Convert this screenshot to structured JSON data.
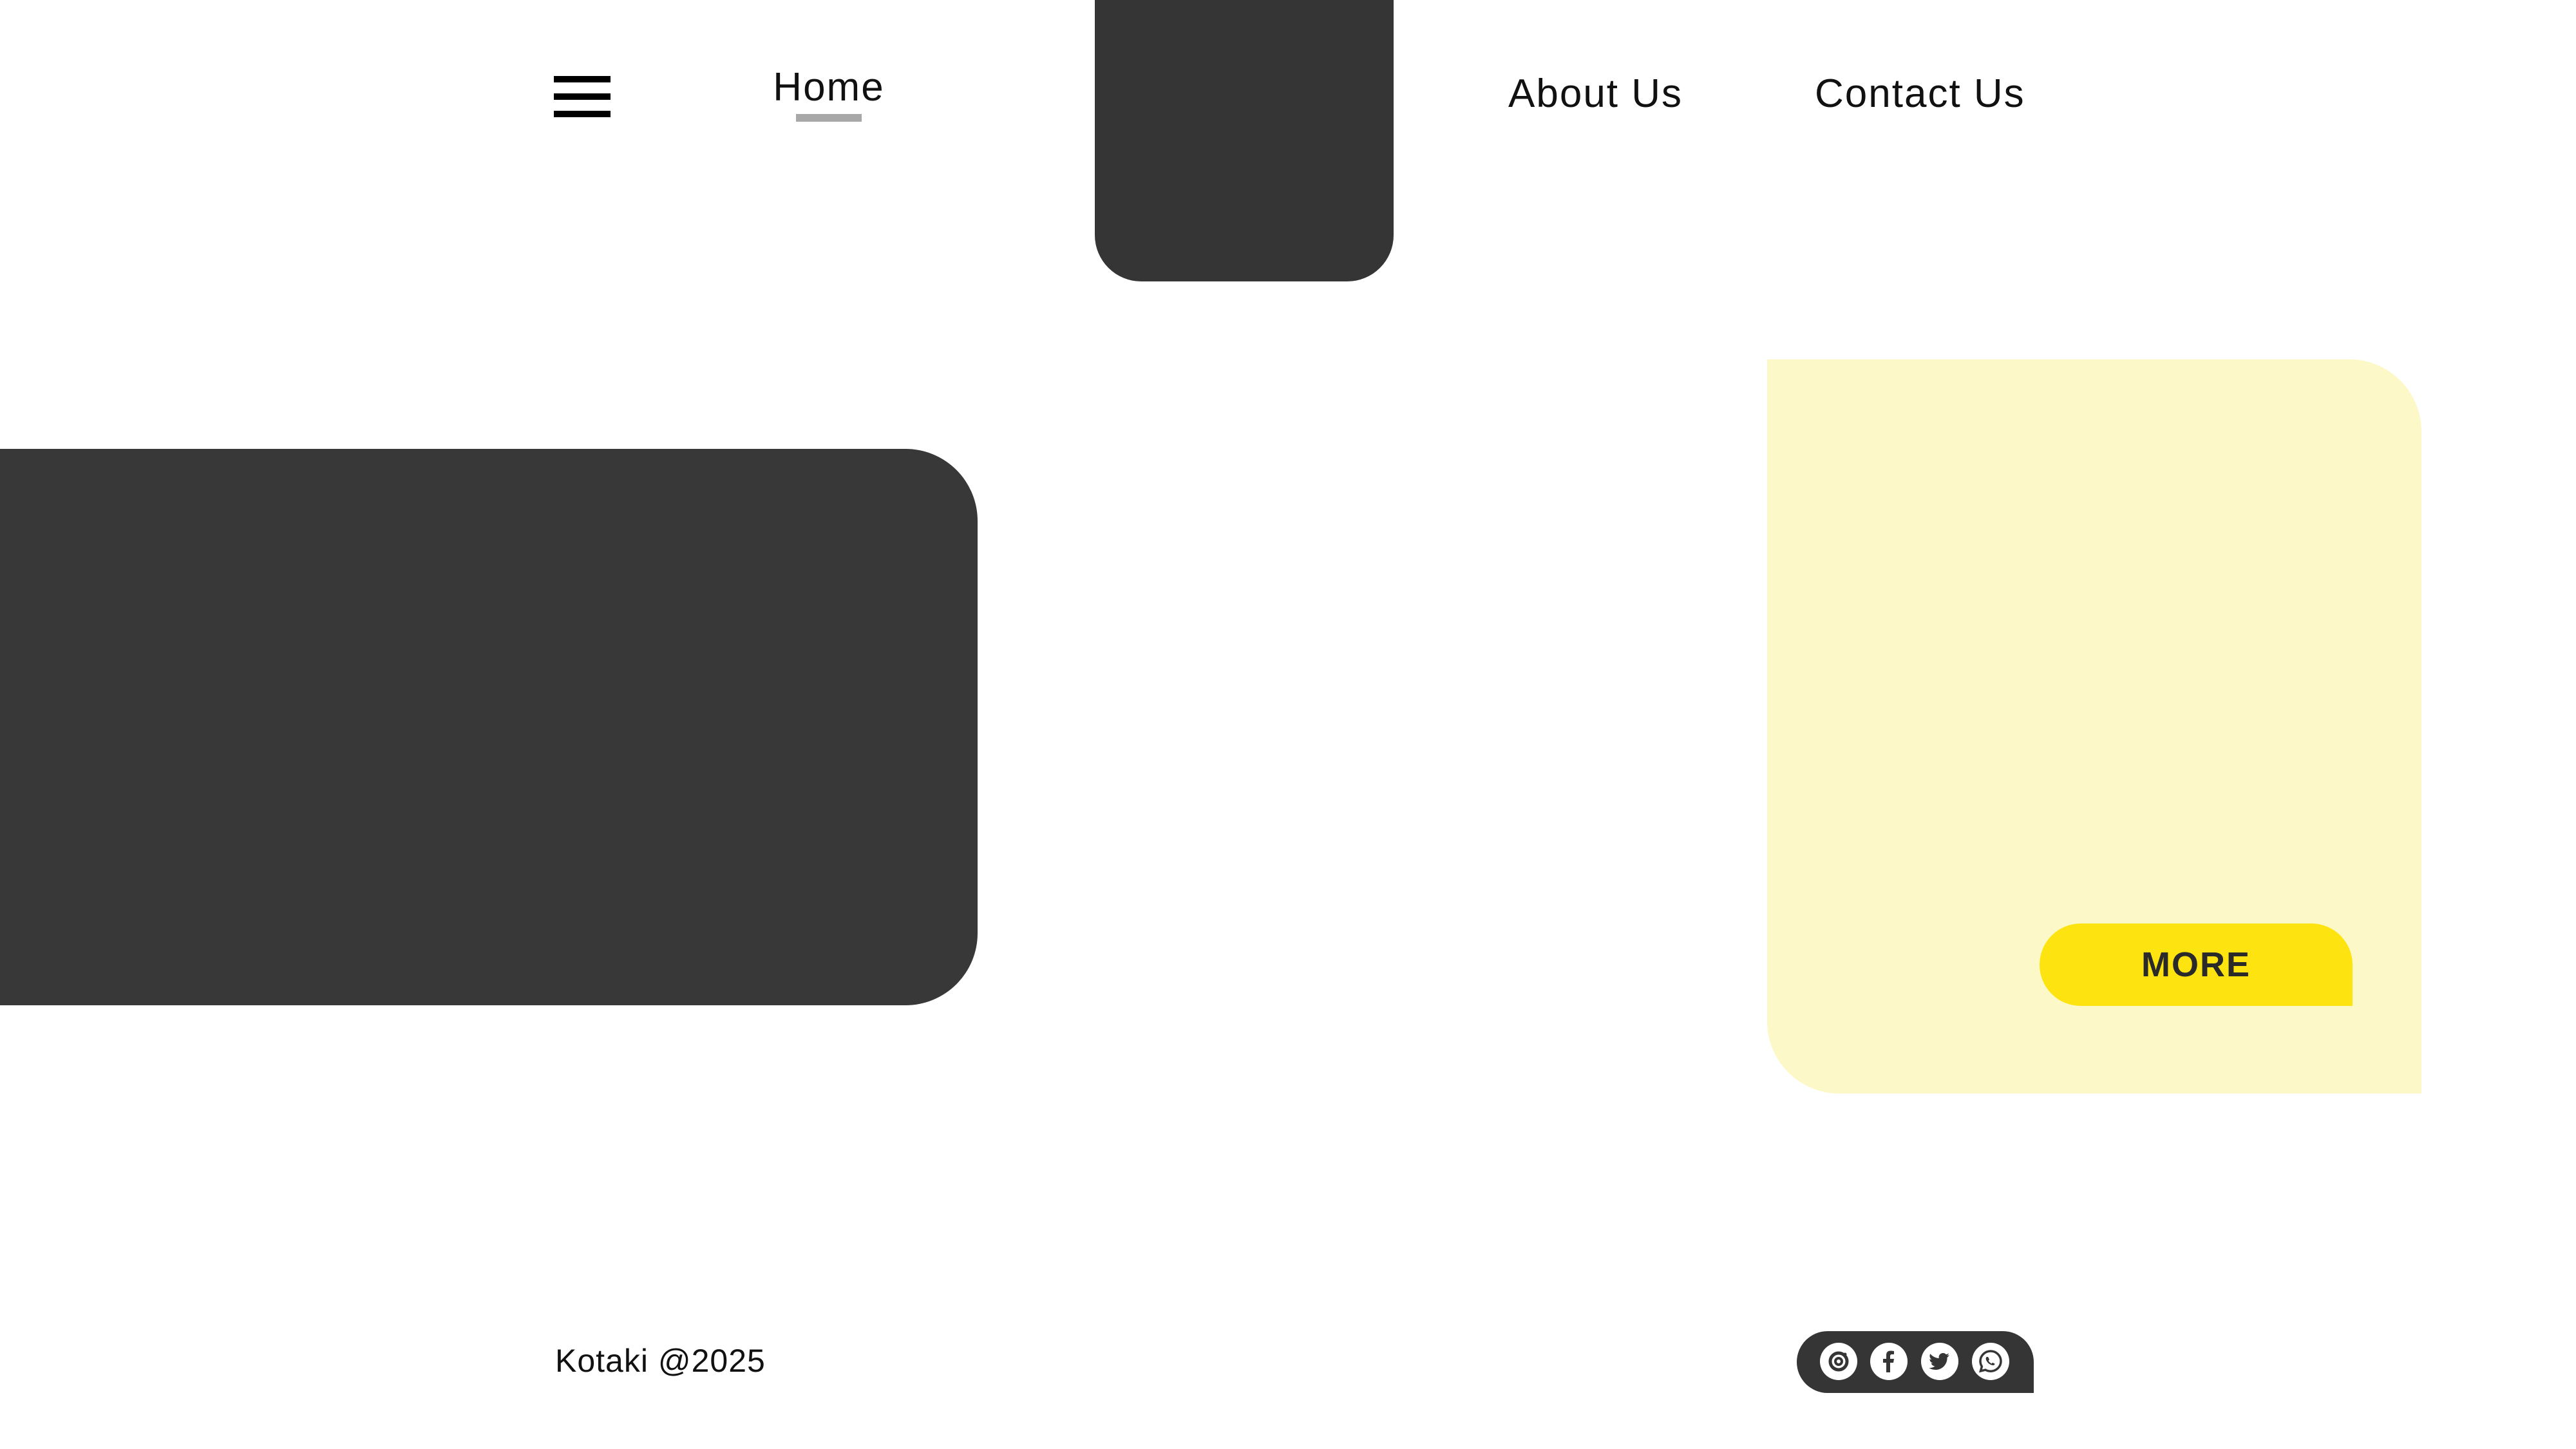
{
  "nav": {
    "home_label": "Home",
    "about_label": "About Us",
    "contact_label": "Contact Us",
    "active": "Home",
    "menu_icon": "hamburger-icon"
  },
  "hero": {
    "more_label": "MORE"
  },
  "footer": {
    "copyright": "Kotaki @2025",
    "social_icons": [
      "instagram-icon",
      "facebook-icon",
      "twitter-icon",
      "whatsapp-icon"
    ]
  },
  "colors": {
    "dark": "#353535",
    "yellow_card": "#fdf8c7",
    "yellow_button": "#fde30f",
    "underline": "#a8a8a8"
  }
}
